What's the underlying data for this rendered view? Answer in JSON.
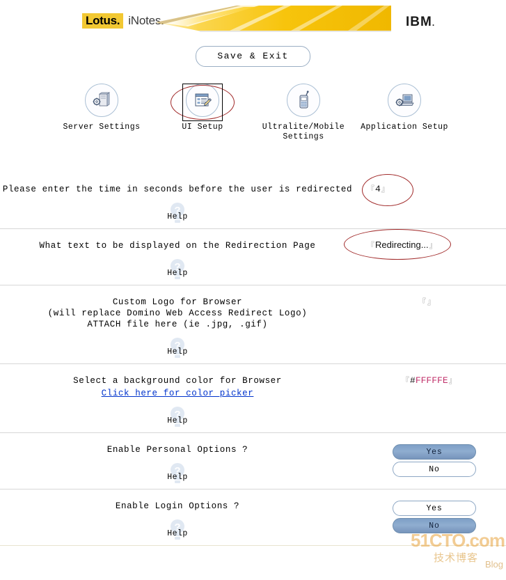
{
  "header": {
    "lotus_mark": "Lotus.",
    "inotes_mark": "iNotes.",
    "ibm_logo": "IBM",
    "ibm_dot": "."
  },
  "toolbar": {
    "save_exit_label": "Save & Exit"
  },
  "nav": {
    "items": [
      {
        "label": "Server Settings",
        "icon": "server-settings-icon",
        "selected": false
      },
      {
        "label": "UI Setup",
        "icon": "ui-setup-icon",
        "selected": true
      },
      {
        "label": "Ultralite/Mobile Settings",
        "label_line1": "Ultralite/Mobile",
        "label_line2": "Settings",
        "icon": "mobile-phone-icon",
        "selected": false
      },
      {
        "label": "Application Setup",
        "icon": "application-setup-icon",
        "selected": false
      }
    ]
  },
  "help_label": "Help",
  "form": {
    "rows": [
      {
        "prompt": "Please enter the time in seconds before the user is redirected",
        "field_type": "text",
        "value": "4",
        "annotated": true
      },
      {
        "prompt": "What text to be displayed on the Redirection Page",
        "field_type": "text",
        "value": "Redirecting...",
        "annotated": true
      },
      {
        "prompt_line1": "Custom Logo for Browser",
        "prompt_line2": "(will replace Domino Web Access Redirect Logo)",
        "prompt_line3": "ATTACH file here (ie .jpg, .gif)",
        "field_type": "text",
        "value": "",
        "annotated": false
      },
      {
        "prompt_line1": "Select a background color for Browser",
        "link_label": "Click here for color picker",
        "field_type": "color",
        "value_hash": "#",
        "value_digits": "FFFFFE",
        "annotated": false
      },
      {
        "prompt": "Enable Personal Options ?",
        "field_type": "radio",
        "options": [
          "Yes",
          "No"
        ],
        "selected": "Yes"
      },
      {
        "prompt": "Enable Login Options ?",
        "field_type": "radio",
        "options": [
          "Yes",
          "No"
        ],
        "selected": "No"
      }
    ]
  },
  "watermark": {
    "main": "51CTO.com",
    "sub": "Blog",
    "cn": "技术博客"
  },
  "colors": {
    "lotus_yellow": "#f2c832",
    "banner_gold": "#f5c518",
    "link_blue": "#0033cc",
    "annotation_red": "#a02828",
    "pill_on": "#8fadd0",
    "hex_value": "#c0306a"
  }
}
